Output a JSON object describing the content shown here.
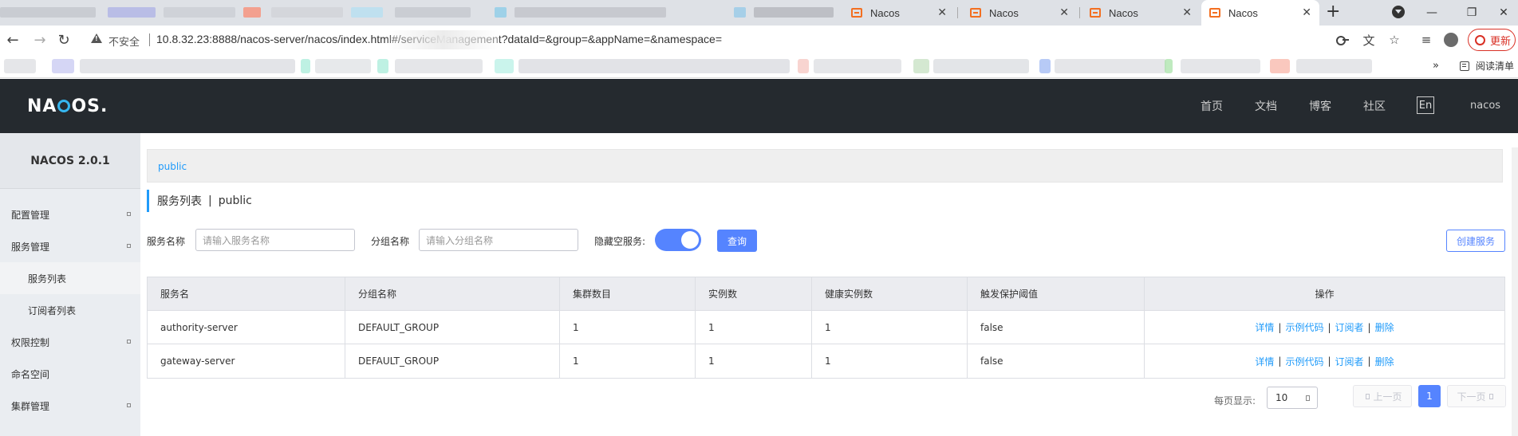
{
  "browser": {
    "tabs": [
      {
        "title": "Nacos"
      },
      {
        "title": "Nacos"
      },
      {
        "title": "Nacos"
      },
      {
        "title": "Nacos",
        "active": true
      }
    ],
    "address": {
      "security_label": "不安全",
      "url": "10.8.32.23:8888/nacos-server/nacos/index.html#/serviceManagement?dataId=&group=&appName=&namespace="
    },
    "update_label": "更新",
    "bookmarks_more": "»",
    "reading_list_label": "阅读清单"
  },
  "header": {
    "logo_text": "NACOS.",
    "nav": [
      "首页",
      "文档",
      "博客",
      "社区"
    ],
    "lang": "En",
    "user": "nacos"
  },
  "sidebar": {
    "title": "NACOS 2.0.1",
    "items": [
      {
        "label": "配置管理",
        "has_arrow": true
      },
      {
        "label": "服务管理",
        "has_arrow": true
      },
      {
        "label": "服务列表",
        "sub": true,
        "selected": true
      },
      {
        "label": "订阅者列表",
        "sub": true
      },
      {
        "label": "权限控制",
        "has_arrow": true
      },
      {
        "label": "命名空间"
      },
      {
        "label": "集群管理",
        "has_arrow": true
      }
    ]
  },
  "main": {
    "namespace_link": "public",
    "page_title": "服务列表",
    "page_title_sep": "|",
    "page_title_ns": "public",
    "filters": {
      "service_name_label": "服务名称",
      "service_name_placeholder": "请输入服务名称",
      "group_name_label": "分组名称",
      "group_name_placeholder": "请输入分组名称",
      "hide_empty_label": "隐藏空服务:",
      "hide_empty_on": true,
      "query_label": "查询",
      "create_label": "创建服务"
    },
    "table": {
      "columns": [
        "服务名",
        "分组名称",
        "集群数目",
        "实例数",
        "健康实例数",
        "触发保护阈值",
        "操作"
      ],
      "rows": [
        [
          "authority-server",
          "DEFAULT_GROUP",
          "1",
          "1",
          "1",
          "false"
        ],
        [
          "gateway-server",
          "DEFAULT_GROUP",
          "1",
          "1",
          "1",
          "false"
        ]
      ],
      "ops": [
        "详情",
        "示例代码",
        "订阅者",
        "删除"
      ]
    },
    "pagination": {
      "page_size_label": "每页显示:",
      "page_size": "10",
      "prev_label": "上一页",
      "next_label": "下一页",
      "current_page": "1"
    }
  },
  "colors": {
    "primary": "#5584ff",
    "link": "#209bfa",
    "header_bg": "#252a2f",
    "sidebar_bg": "#eaedf1"
  }
}
